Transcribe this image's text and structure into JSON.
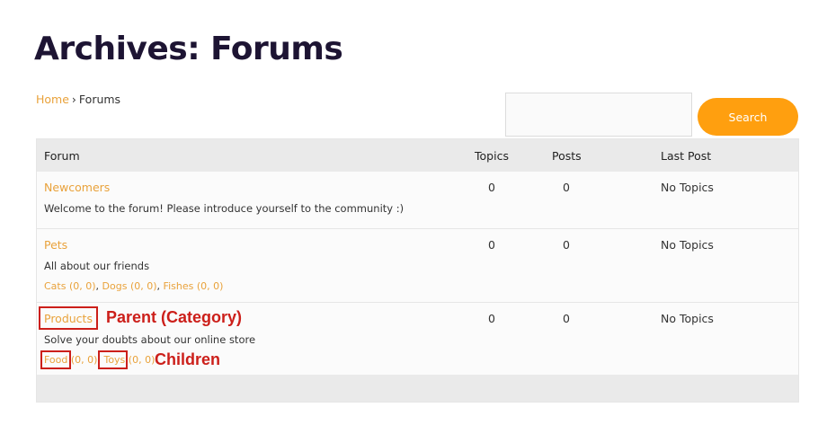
{
  "page": {
    "title": "Archives: Forums"
  },
  "breadcrumb": {
    "home": "Home",
    "separator": "›",
    "current": "Forums"
  },
  "search": {
    "placeholder": "",
    "button_label": "Search"
  },
  "table": {
    "headers": {
      "forum": "Forum",
      "topics": "Topics",
      "posts": "Posts",
      "last_post": "Last Post"
    },
    "rows": [
      {
        "name": "Newcomers",
        "description": "Welcome to the forum! Please introduce yourself to the community :)",
        "topics": "0",
        "posts": "0",
        "last_post": "No Topics",
        "subforums": []
      },
      {
        "name": "Pets",
        "description": "All about our friends",
        "topics": "0",
        "posts": "0",
        "last_post": "No Topics",
        "subforums": [
          {
            "name": "Cats",
            "counts": " (0, 0)"
          },
          {
            "name": "Dogs",
            "counts": " (0, 0)"
          },
          {
            "name": "Fishes",
            "counts": " (0, 0)"
          }
        ]
      },
      {
        "name": "Products",
        "description": "Solve your doubts about our online store",
        "topics": "0",
        "posts": "0",
        "last_post": "No Topics",
        "subforums": [
          {
            "name": "Food",
            "counts": " (0, 0)"
          },
          {
            "name": "Toys",
            "counts": " (0, 0)"
          }
        ]
      }
    ]
  },
  "annotations": {
    "parent_label": "Parent (Category)",
    "children_label": "Children",
    "color": "#cc1f1a"
  },
  "colors": {
    "accent": "#ff9f0f",
    "link": "#e9a23b",
    "title": "#1d1433"
  }
}
